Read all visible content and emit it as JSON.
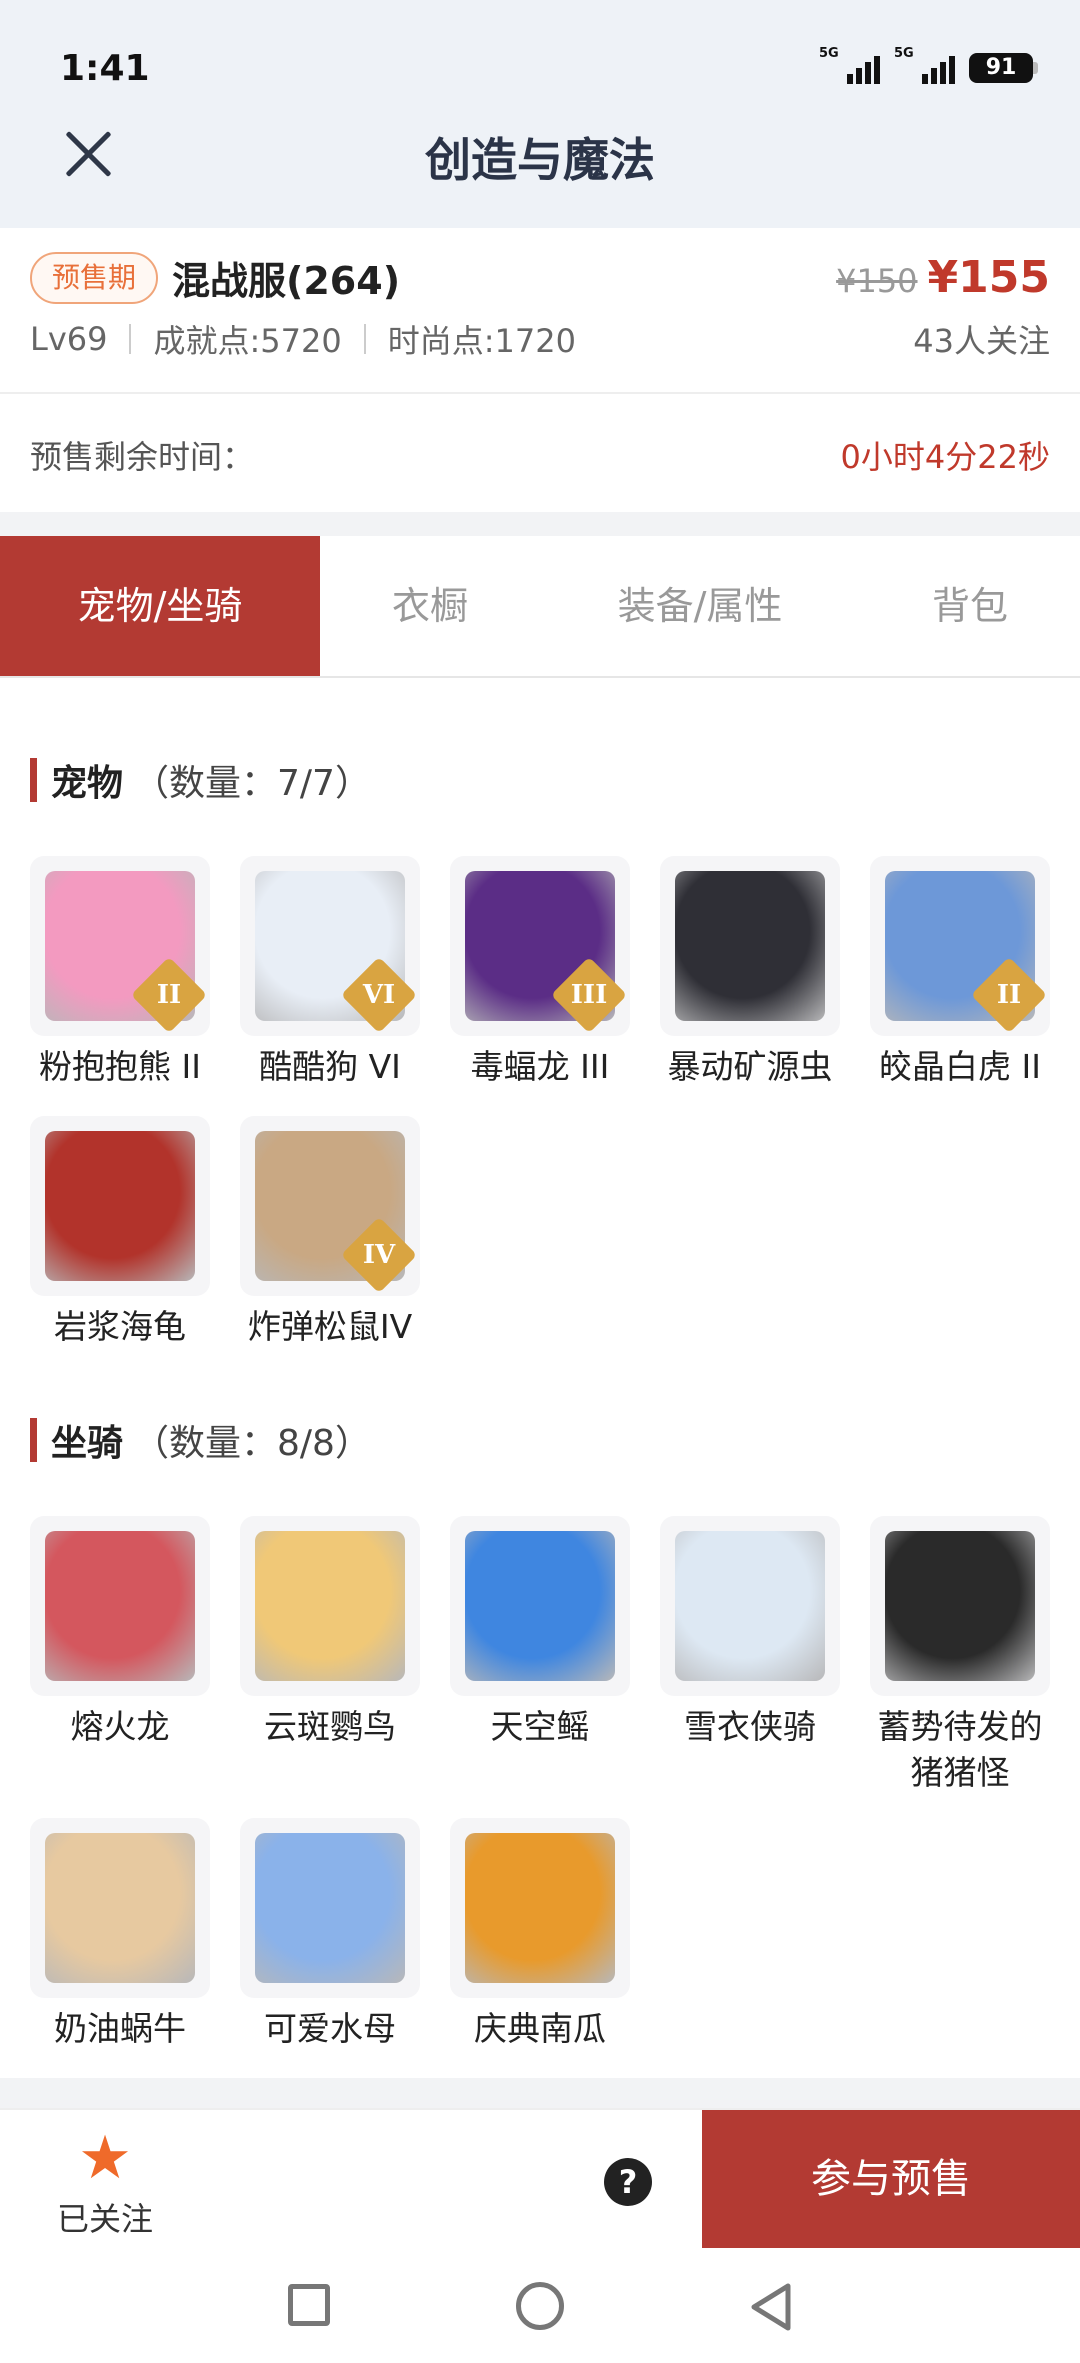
{
  "status": {
    "time": "1:41",
    "signal1": "5G",
    "signal2": "5G",
    "battery": "91"
  },
  "header": {
    "title": "创造与魔法"
  },
  "product": {
    "badge": "预售期",
    "name": "混战服(264)",
    "old_price": "¥150",
    "price": "¥155",
    "level": "Lv69",
    "achievement": "成就点:5720",
    "fashion": "时尚点:1720",
    "followers": "43人关注"
  },
  "countdown": {
    "label": "预售剩余时间：",
    "value": "0小时4分22秒"
  },
  "tabs": [
    {
      "label": "宠物/坐骑",
      "active": true
    },
    {
      "label": "衣橱",
      "active": false
    },
    {
      "label": "装备/属性",
      "active": false
    },
    {
      "label": "背包",
      "active": false
    }
  ],
  "pets": {
    "title": "宠物",
    "count": "（数量：7/7）",
    "items": [
      {
        "label": "粉抱抱熊 II",
        "tier": "II",
        "icon": "pink-bear-icon",
        "color": "#f39ac0"
      },
      {
        "label": "酷酷狗 VI",
        "tier": "VI",
        "icon": "cool-dog-icon",
        "color": "#e8eef6"
      },
      {
        "label": "毒蝠龙 III",
        "tier": "III",
        "icon": "poison-bat-dragon-icon",
        "color": "#5b2d86"
      },
      {
        "label": "暴动矿源虫",
        "tier": "",
        "icon": "riot-ore-bug-icon",
        "color": "#2f2f36"
      },
      {
        "label": "皎晶白虎 II",
        "tier": "II",
        "icon": "white-tiger-icon",
        "color": "#6d98d8"
      },
      {
        "label": "岩浆海龟",
        "tier": "",
        "icon": "lava-turtle-icon",
        "color": "#b2332b"
      },
      {
        "label": "炸弹松鼠IV",
        "tier": "IV",
        "icon": "bomb-squirrel-icon",
        "color": "#c9a883"
      }
    ]
  },
  "mounts": {
    "title": "坐骑",
    "count": "（数量：8/8）",
    "items": [
      {
        "label": "熔火龙",
        "icon": "molten-dragon-icon",
        "color": "#d4575e"
      },
      {
        "label": "云斑鹦鸟",
        "icon": "cloud-parrot-icon",
        "color": "#f0c877"
      },
      {
        "label": "天空鳐",
        "icon": "sky-ray-icon",
        "color": "#3f86e0"
      },
      {
        "label": "雪衣侠骑",
        "icon": "snow-horse-icon",
        "color": "#dde8f3"
      },
      {
        "label": "蓄势待发的猪猪怪",
        "icon": "pig-monster-icon",
        "color": "#2a2a2a"
      },
      {
        "label": "奶油蜗牛",
        "icon": "cream-snail-icon",
        "color": "#e7c9a0"
      },
      {
        "label": "可爱水母",
        "icon": "cute-jellyfish-icon",
        "color": "#8ab2ea"
      },
      {
        "label": "庆典南瓜",
        "icon": "festival-pumpkin-icon",
        "color": "#e89a2c"
      }
    ]
  },
  "bottom": {
    "follow_label": "已关注",
    "help": "?",
    "cta": "参与预售"
  },
  "colors": {
    "accent": "#b33a33",
    "price": "#c0392b",
    "star": "#ef6a2a",
    "badge": "#e8703a"
  }
}
